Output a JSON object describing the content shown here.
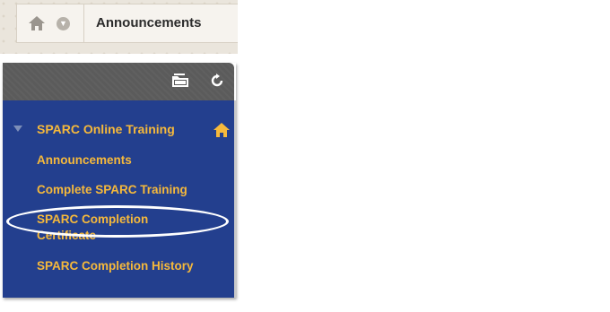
{
  "breadcrumb": {
    "title": "Announcements",
    "home_icon": "home-icon",
    "menu_icon": "chevron-down-icon"
  },
  "menu_toolbar": {
    "icons": [
      "folder-view-icon",
      "refresh-icon"
    ]
  },
  "course_menu": {
    "course_title": "SPARC Online Training",
    "items": [
      {
        "label": "Announcements"
      },
      {
        "label": "Complete SPARC Training"
      },
      {
        "label": "SPARC Completion Certificate"
      },
      {
        "label": "SPARC Completion History"
      }
    ],
    "highlighted_item": "Complete SPARC Training"
  },
  "colors": {
    "menu_background": "#233f8e",
    "link": "#f6b93b",
    "toolbar": "#5b5b5b"
  }
}
